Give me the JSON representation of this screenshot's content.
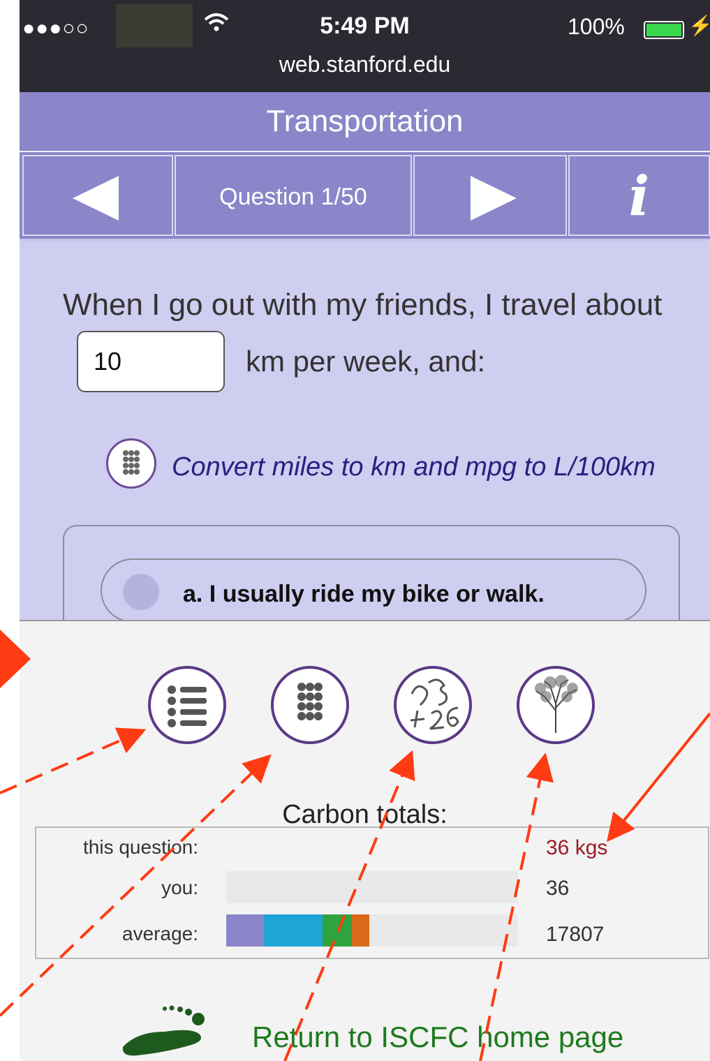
{
  "status_bar": {
    "signal": "●●●○○",
    "time": "5:49 PM",
    "url": "web.stanford.edu",
    "battery": "100%",
    "battery_level": 1.0
  },
  "header": {
    "title": "Transportation"
  },
  "nav": {
    "question_label": "Question 1/50",
    "info_label": "i"
  },
  "question": {
    "text": "When I go out with my friends, I travel about",
    "km_value": "10",
    "unit_text": "km per week, and:",
    "convert_link": "Convert miles to km and mpg to L/100km"
  },
  "options": [
    {
      "label": "a. I usually ride my bike or walk."
    }
  ],
  "carbon": {
    "title": "Carbon totals:",
    "rows": [
      {
        "label": "this question:",
        "value": "36 kgs"
      },
      {
        "label": "you:",
        "value": "36"
      },
      {
        "label": "average:",
        "value": "17807"
      }
    ],
    "average_segments": [
      {
        "fraction": 0.13,
        "color": "#8b86c9"
      },
      {
        "fraction": 0.2,
        "color": "#1ea4d6"
      },
      {
        "fraction": 0.1,
        "color": "#2fa33e"
      },
      {
        "fraction": 0.06,
        "color": "#d86a1a"
      }
    ]
  },
  "footer": {
    "home_link": "Return to ISCFC home page"
  },
  "icons": [
    "menu-list-icon",
    "calculator-icon",
    "numbers-icon",
    "tree-icon",
    "footprint-icon",
    "wifi-icon"
  ],
  "colors": {
    "accent": "#8b86c9",
    "background": "#cfcdf0",
    "link": "#25207f",
    "annotation": "#ff3b13",
    "home_link": "#1e7a1e"
  }
}
